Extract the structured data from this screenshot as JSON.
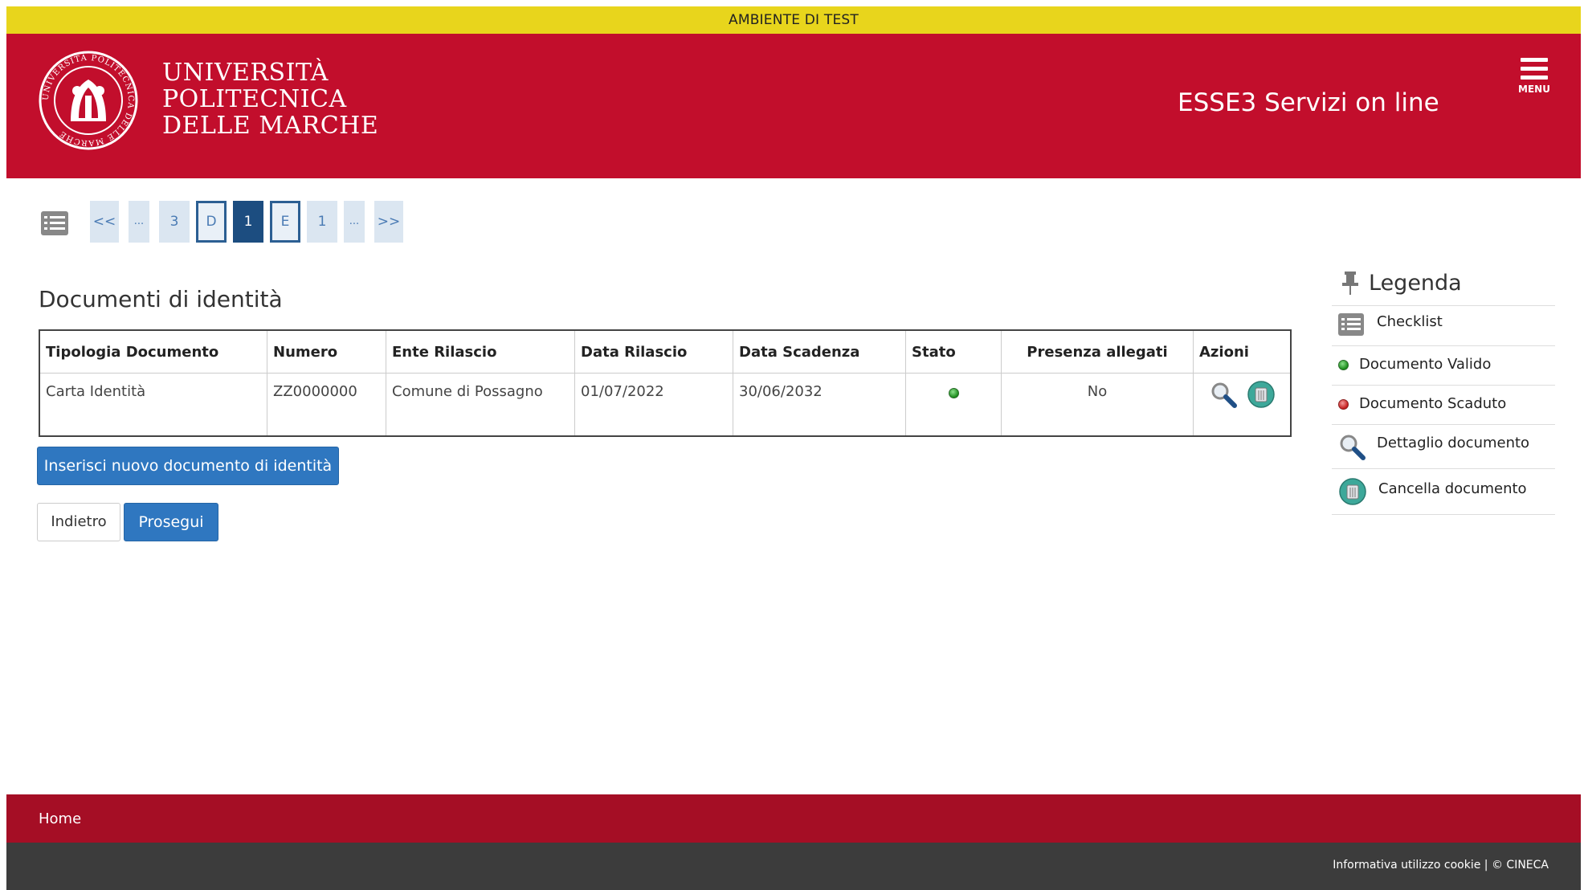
{
  "banner": {
    "text": "AMBIENTE DI TEST"
  },
  "header": {
    "university_lines": [
      "UNIVERSITÀ",
      "POLITECNICA",
      "DELLE MARCHE"
    ],
    "seal_text": "UNIVERSITÀ POLITECNICA DELLE MARCHE",
    "service_title": "ESSE3 Servizi on line",
    "menu_label": "MENU"
  },
  "steps": [
    "<<",
    "...",
    "3",
    "D",
    "1",
    "E",
    "1",
    "...",
    ">>"
  ],
  "page": {
    "title": "Documenti di identità"
  },
  "table": {
    "headers": [
      "Tipologia Documento",
      "Numero",
      "Ente Rilascio",
      "Data Rilascio",
      "Data Scadenza",
      "Stato",
      "Presenza allegati",
      "Azioni"
    ],
    "rows": [
      {
        "tipologia": "Carta Identità",
        "numero": "ZZ0000000",
        "ente": "Comune di Possagno",
        "data_rilascio": "01/07/2022",
        "data_scadenza": "30/06/2032",
        "stato": "green-dot-icon",
        "allegati": "No",
        "azioni": [
          "magnifier-icon",
          "trash-icon"
        ]
      }
    ]
  },
  "buttons": {
    "insert_label": "Inserisci nuovo documento di identità",
    "back_label": "Indietro",
    "next_label": "Prosegui"
  },
  "legend": {
    "title": "Legenda",
    "items": [
      {
        "icon": "checklist-icon",
        "label": "Checklist"
      },
      {
        "icon": "green-dot-icon",
        "label": "Documento Valido"
      },
      {
        "icon": "red-dot-icon",
        "label": "Documento Scaduto"
      },
      {
        "icon": "magnifier-icon",
        "label": "Dettaglio documento"
      },
      {
        "icon": "trash-icon",
        "label": "Cancella documento"
      }
    ]
  },
  "footer": {
    "home_label": "Home",
    "cookie_label": "Informativa utilizzo cookie",
    "separator": "|",
    "copyright": "© CINECA"
  },
  "colors": {
    "test_banner": "#e8d51c",
    "header_red": "#c20e2c",
    "footer_red": "#a50e25",
    "footer_dark": "#3c3c3c",
    "primary_button": "#2f77c0",
    "step_active": "#1c4d80"
  }
}
